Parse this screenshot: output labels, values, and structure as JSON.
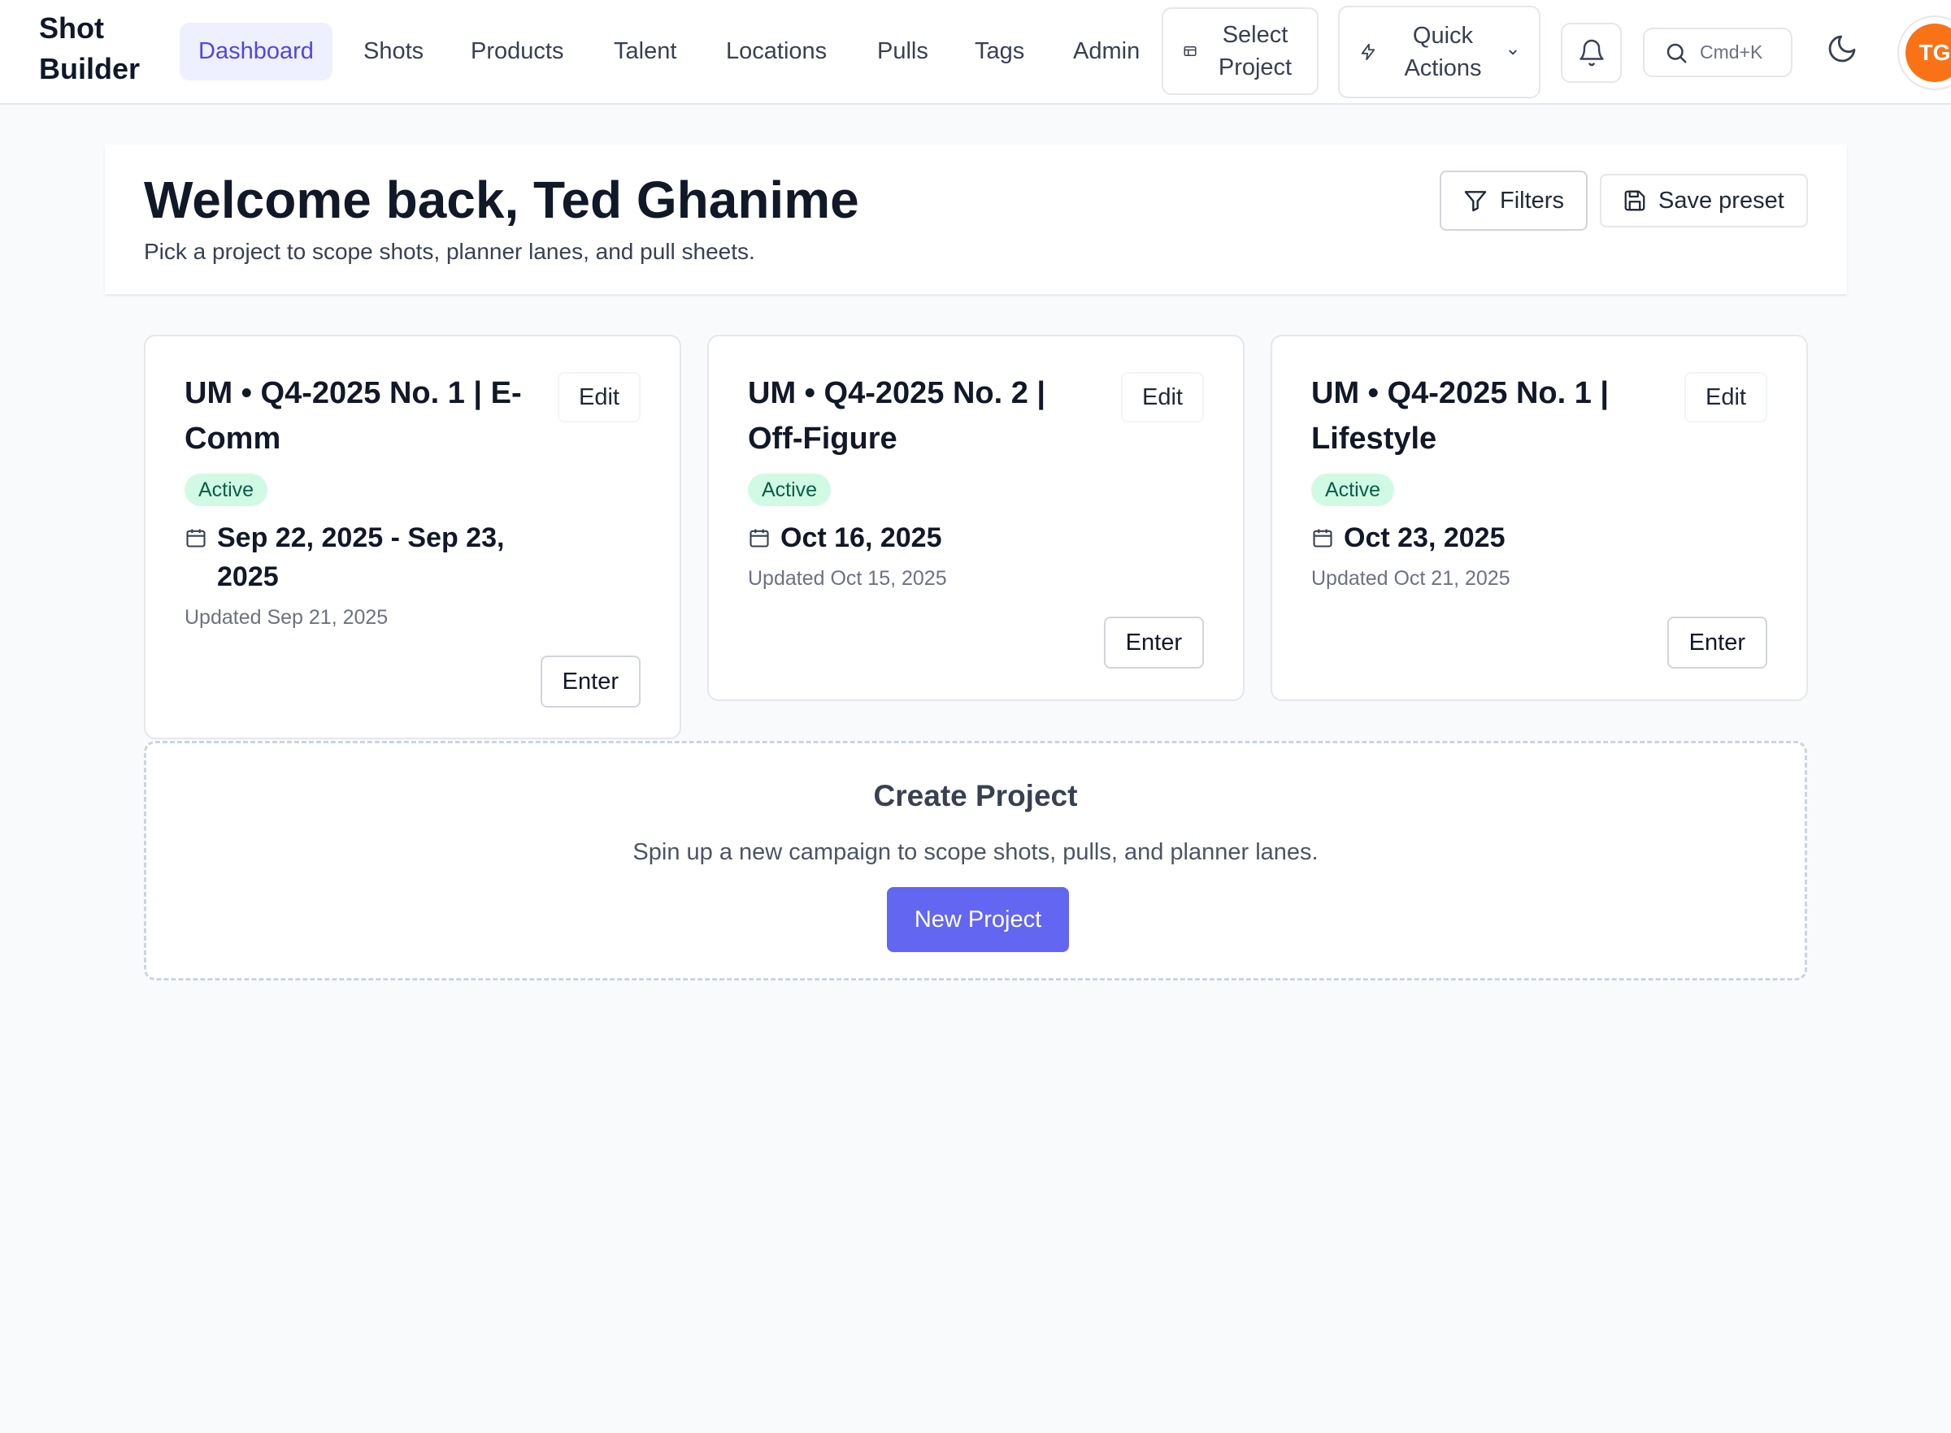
{
  "brand": {
    "line1": "Shot",
    "line2": "Builder"
  },
  "nav": {
    "items": [
      {
        "label": "Dashboard",
        "active": true
      },
      {
        "label": "Shots"
      },
      {
        "label": "Products"
      },
      {
        "label": "Talent"
      },
      {
        "label": "Locations"
      },
      {
        "label": "Pulls"
      },
      {
        "label": "Tags"
      },
      {
        "label": "Admin"
      }
    ],
    "select_project": {
      "line1": "Select",
      "line2": "Project",
      "icon": "project-icon"
    },
    "quick_actions": {
      "line1": "Quick",
      "line2": "Actions",
      "icon": "bolt-icon"
    },
    "notifications_icon": "bell-icon",
    "search": {
      "shortcut": "Cmd+K",
      "icon": "search-icon"
    },
    "theme_icon": "moon-icon",
    "avatar_initials": "TG"
  },
  "header": {
    "title": "Welcome back, Ted Ghanime",
    "subtitle": "Pick a project to scope shots, planner lanes, and pull sheets.",
    "filters_label": "Filters",
    "save_preset_label": "Save preset"
  },
  "projects": [
    {
      "title": "UM • Q4-2025 No. 1 | E-Comm",
      "status": "Active",
      "date": "Sep 22, 2025 - Sep 23, 2025",
      "updated": "Updated Sep 21, 2025",
      "edit_label": "Edit",
      "enter_label": "Enter"
    },
    {
      "title": "UM • Q4-2025 No. 2 | Off-Figure",
      "status": "Active",
      "date": "Oct 16, 2025",
      "updated": "Updated Oct 15, 2025",
      "edit_label": "Edit",
      "enter_label": "Enter"
    },
    {
      "title": "UM • Q4-2025 No. 1 | Lifestyle",
      "status": "Active",
      "date": "Oct 23, 2025",
      "updated": "Updated Oct 21, 2025",
      "edit_label": "Edit",
      "enter_label": "Enter"
    }
  ],
  "create": {
    "title": "Create Project",
    "description": "Spin up a new campaign to scope shots, pulls, and planner lanes.",
    "button_label": "New Project"
  },
  "colors": {
    "accent": "#6366f1",
    "nav_active_bg": "#eef0ff",
    "status_bg": "#d1fae5",
    "status_text": "#065f46",
    "avatar": "#f97316"
  }
}
